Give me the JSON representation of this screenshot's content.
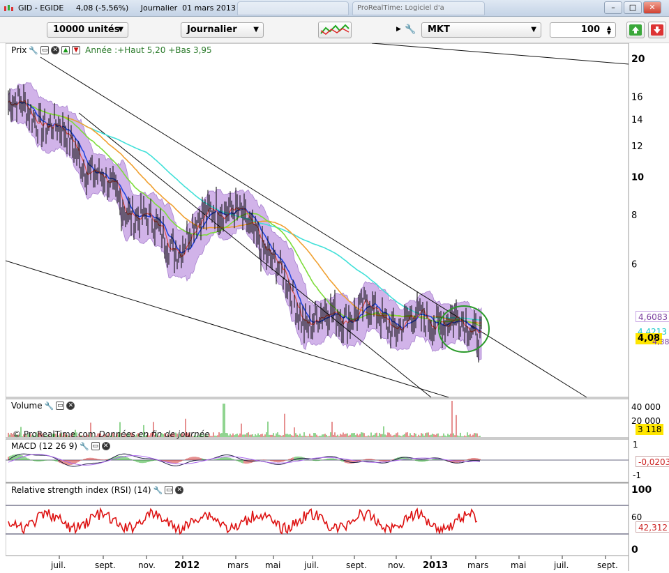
{
  "window": {
    "title": "GID - EGIDE     4,08 (-5,56%)     Journalier  01 mars 2013",
    "ghost_tabs": [
      "",
      "ProRealTime: Logiciel d'a"
    ]
  },
  "toolbar": {
    "units_select": "10000 unités",
    "period_select": "Journalier",
    "market_select": "MKT",
    "quantity": "100"
  },
  "price_panel": {
    "label": "Prix",
    "annotation": "Année :+Haut 5,20 +Bas 3,95",
    "y_ticks": [
      "20",
      "16",
      "14",
      "12",
      "10",
      "8",
      "6"
    ],
    "value_tags": [
      {
        "text": "4,6083",
        "color": "#7b3f9f"
      },
      {
        "text": "4,4213",
        "color": "#19c9c9"
      },
      {
        "text": "4,08",
        "color": "#000000"
      },
      {
        "text": "4,3867",
        "color": "#7b3f9f"
      }
    ],
    "copyright": "© ProRealTime.com",
    "copyright_note": "Données en fin de journée"
  },
  "volume_panel": {
    "label": "Volume",
    "y_ticks": [
      "40 000",
      "20 000"
    ],
    "value_tag": "3 118"
  },
  "macd_panel": {
    "label": "MACD (12 26 9)",
    "y_ticks": [
      "1",
      "-1"
    ],
    "value_tag": "-0,0203"
  },
  "rsi_panel": {
    "label": "Relative strength index (RSI) (14)",
    "y_ticks": [
      "100",
      "60",
      "0"
    ],
    "value_tag": "42,312"
  },
  "x_axis": {
    "labels": [
      "juil.",
      "sept.",
      "nov.",
      "2012",
      "mars",
      "mai",
      "juil.",
      "sept.",
      "nov.",
      "2013",
      "mars",
      "mai",
      "juil.",
      "sept."
    ]
  },
  "colors": {
    "bollinger_fill": "#c9a6e6",
    "ma_red": "#e0524a",
    "ma_blue": "#2244dd",
    "ma_green": "#7ddc3a",
    "ma_orange": "#f0a030",
    "ma_cyan": "#40e0d8",
    "rsi": "#dd1111",
    "highlight_circle": "#2a9a2a"
  },
  "chart_data": {
    "type": "line",
    "title": "GID - EGIDE",
    "x_labels": [
      "juil.",
      "sept.",
      "nov.",
      "2012",
      "mars",
      "mai",
      "juil.",
      "sept.",
      "nov.",
      "2013",
      "mars"
    ],
    "series": [
      {
        "name": "",
        "values": [
          15.5,
          13.5,
          8.8,
          6.6,
          8.7,
          7.2,
          4.3,
          4.6,
          4.2,
          4.4,
          4.08
        ]
      }
    ],
    "ylim": [
      3,
      21
    ],
    "scale": "log"
  }
}
